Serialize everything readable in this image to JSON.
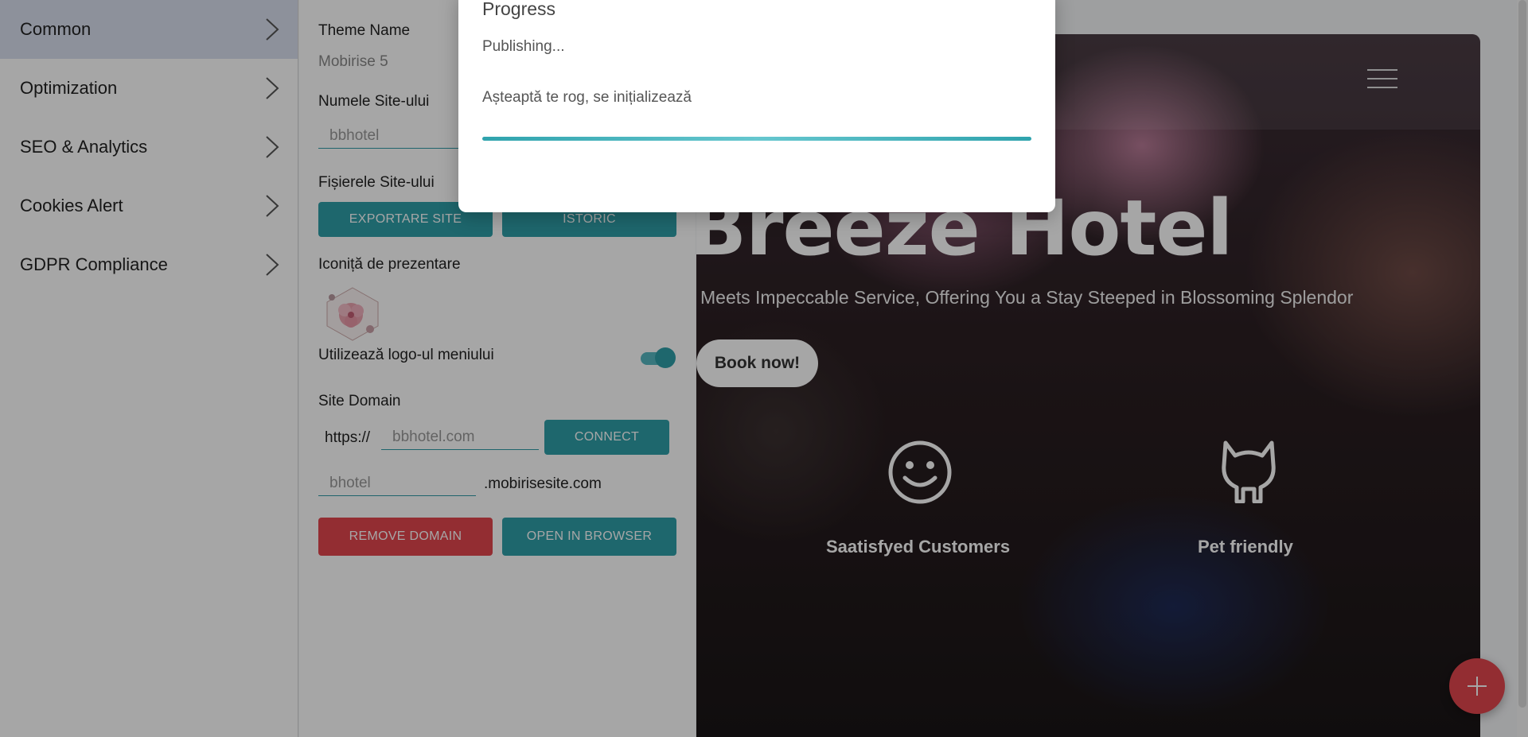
{
  "sidebar": {
    "items": [
      {
        "label": "Common",
        "active": true
      },
      {
        "label": "Optimization"
      },
      {
        "label": "SEO & Analytics"
      },
      {
        "label": "Cookies Alert"
      },
      {
        "label": "GDPR Compliance"
      }
    ]
  },
  "settings": {
    "theme_name_label": "Theme Name",
    "theme_name_value": "Mobirise 5",
    "site_name_label": "Numele Site-ului",
    "site_name_value": "bbhotel",
    "site_files_label": "Fișierele Site-ului",
    "export_button": "EXPORTARE SITE",
    "history_button": "ISTORIC",
    "favicon_label": "Iconiță de prezentare",
    "use_logo_label": "Utilizează logo-ul meniului",
    "use_logo_enabled": true,
    "domain_label": "Site Domain",
    "https_prefix": "https://",
    "domain_placeholder": "bbhotel.com",
    "connect_button": "CONNECT",
    "subdomain_value": "bhotel",
    "subdomain_suffix": ".mobirisesite.com",
    "remove_domain_button": "REMOVE DOMAIN",
    "open_browser_button": "OPEN IN BROWSER"
  },
  "preview": {
    "hero_title": "Breeze Hotel",
    "hero_subtitle": "Meets Impeccable Service, Offering You a Stay Steeped in Blossoming Splendor",
    "book_button": "Book now!",
    "features": [
      {
        "icon": "smiley-icon",
        "label": "Saatisfyed Customers"
      },
      {
        "icon": "cat-icon",
        "label": "Pet friendly"
      }
    ]
  },
  "modal": {
    "title": "Progress",
    "status": "Publishing...",
    "message": "Așteaptă te rog, se inițializează"
  },
  "colors": {
    "accent": "#2f9ea8",
    "danger": "#e2464e",
    "sidebar_active": "#d9dfef"
  }
}
